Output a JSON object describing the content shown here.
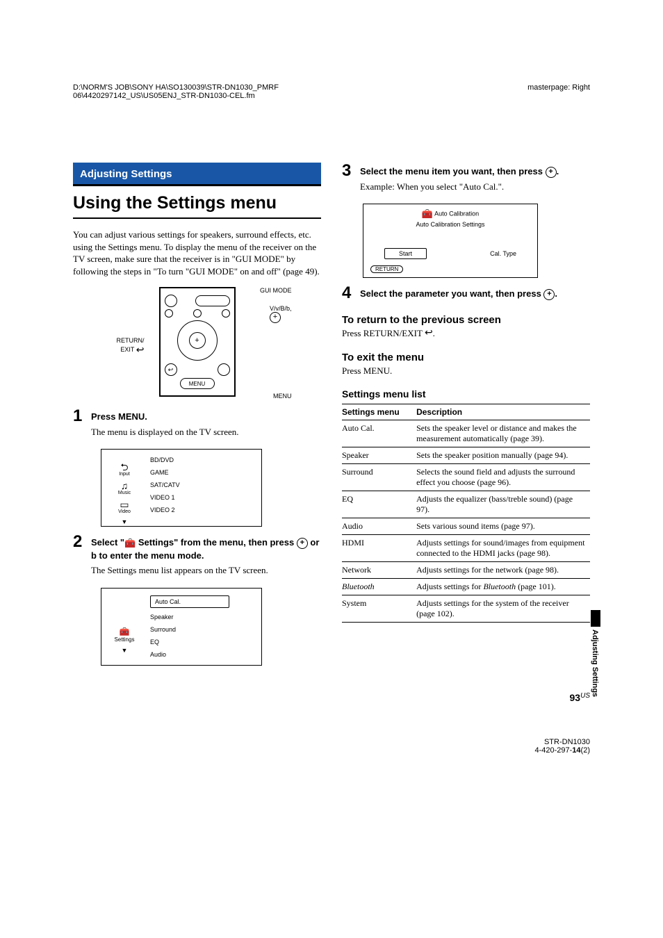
{
  "header": {
    "path_line1": "D:\\NORM'S JOB\\SONY HA\\SO130039\\STR-DN1030_PMRF",
    "path_line2": "06\\4420297142_US\\US05ENJ_STR-DN1030-CEL.fm",
    "masterpage": "masterpage: Right"
  },
  "section_tag": "Adjusting Settings",
  "title": "Using the Settings menu",
  "intro": "You can adjust various settings for speakers, surround effects, etc. using the Settings menu. To display the menu of the receiver on the TV screen, make sure that the receiver is in \"GUI MODE\" by following the steps in \"To turn \"GUI MODE\" on and off\" (page 49).",
  "remote_labels": {
    "gui_mode": "GUI MODE",
    "arrows": "V/v/B/b,",
    "menu": "MENU",
    "return_exit": "RETURN/\nEXIT",
    "menu_btn": "MENU"
  },
  "steps": [
    {
      "num": "1",
      "head": "Press MENU.",
      "text": "The menu is displayed on the TV screen."
    },
    {
      "num": "2",
      "head_pre": "Select \"",
      "head_post": " Settings\" from the menu, then press ",
      "head_tail": " or b to enter the menu mode.",
      "text": "The Settings menu list appears on the TV screen."
    },
    {
      "num": "3",
      "head_pre": "Select the menu item you want, then press ",
      "head_post": ".",
      "text": "Example: When you select \"Auto Cal.\"."
    },
    {
      "num": "4",
      "head_pre": "Select the parameter you want, then press ",
      "head_post": "."
    }
  ],
  "tv_menu1": {
    "icons": [
      {
        "sym": "⮌",
        "cap": "Input"
      },
      {
        "sym": "♫",
        "cap": "Music"
      },
      {
        "sym": "▭",
        "cap": "Video"
      }
    ],
    "arrow": "▼",
    "items": [
      "BD/DVD",
      "GAME",
      "SAT/CATV",
      "VIDEO 1",
      "VIDEO 2"
    ]
  },
  "tv_menu2": {
    "settings_sym": "🧰",
    "settings_cap": "Settings",
    "arrow": "▼",
    "items": [
      "Auto Cal.",
      "Speaker",
      "Surround",
      "EQ",
      "Audio"
    ]
  },
  "autocal": {
    "title": "Auto Calibration",
    "sub": "Auto Calibration Settings",
    "start": "Start",
    "caltype": "Cal. Type",
    "return": "RETURN"
  },
  "sub_return_h": "To return to the previous screen",
  "sub_return_t": "Press RETURN/EXIT ",
  "sub_exit_h": "To exit the menu",
  "sub_exit_t": "Press MENU.",
  "table_heading": "Settings menu list",
  "table": {
    "headers": [
      "Settings menu",
      "Description"
    ],
    "rows": [
      {
        "a": "Auto Cal.",
        "b": "Sets the speaker level or distance and makes the measurement automatically (page 39)."
      },
      {
        "a": "Speaker",
        "b": "Sets the speaker position manually (page 94)."
      },
      {
        "a": "Surround",
        "b": "Selects the sound field and adjusts the surround effect you choose (page 96)."
      },
      {
        "a": "EQ",
        "b": "Adjusts the equalizer (bass/treble sound) (page 97)."
      },
      {
        "a": "Audio",
        "b": "Sets various sound items (page 97)."
      },
      {
        "a": "HDMI",
        "b": "Adjusts settings for sound/images from equipment connected to the HDMI jacks (page 98)."
      },
      {
        "a": "Network",
        "b": "Adjusts settings for the network (page 98)."
      },
      {
        "a": "Bluetooth",
        "b_pre": "Adjusts settings for ",
        "b_em": "Bluetooth",
        "b_post": " (page 101).",
        "italic_a": true
      },
      {
        "a": "System",
        "b": "Adjusts settings for the system of the receiver (page 102)."
      }
    ]
  },
  "side_tab": "Adjusting Settings",
  "page_number": "93",
  "page_region": "US",
  "footer_model": "STR-DN1030",
  "footer_code_pre": "4-420-297-",
  "footer_code_bold": "14",
  "footer_code_post": "(2)"
}
